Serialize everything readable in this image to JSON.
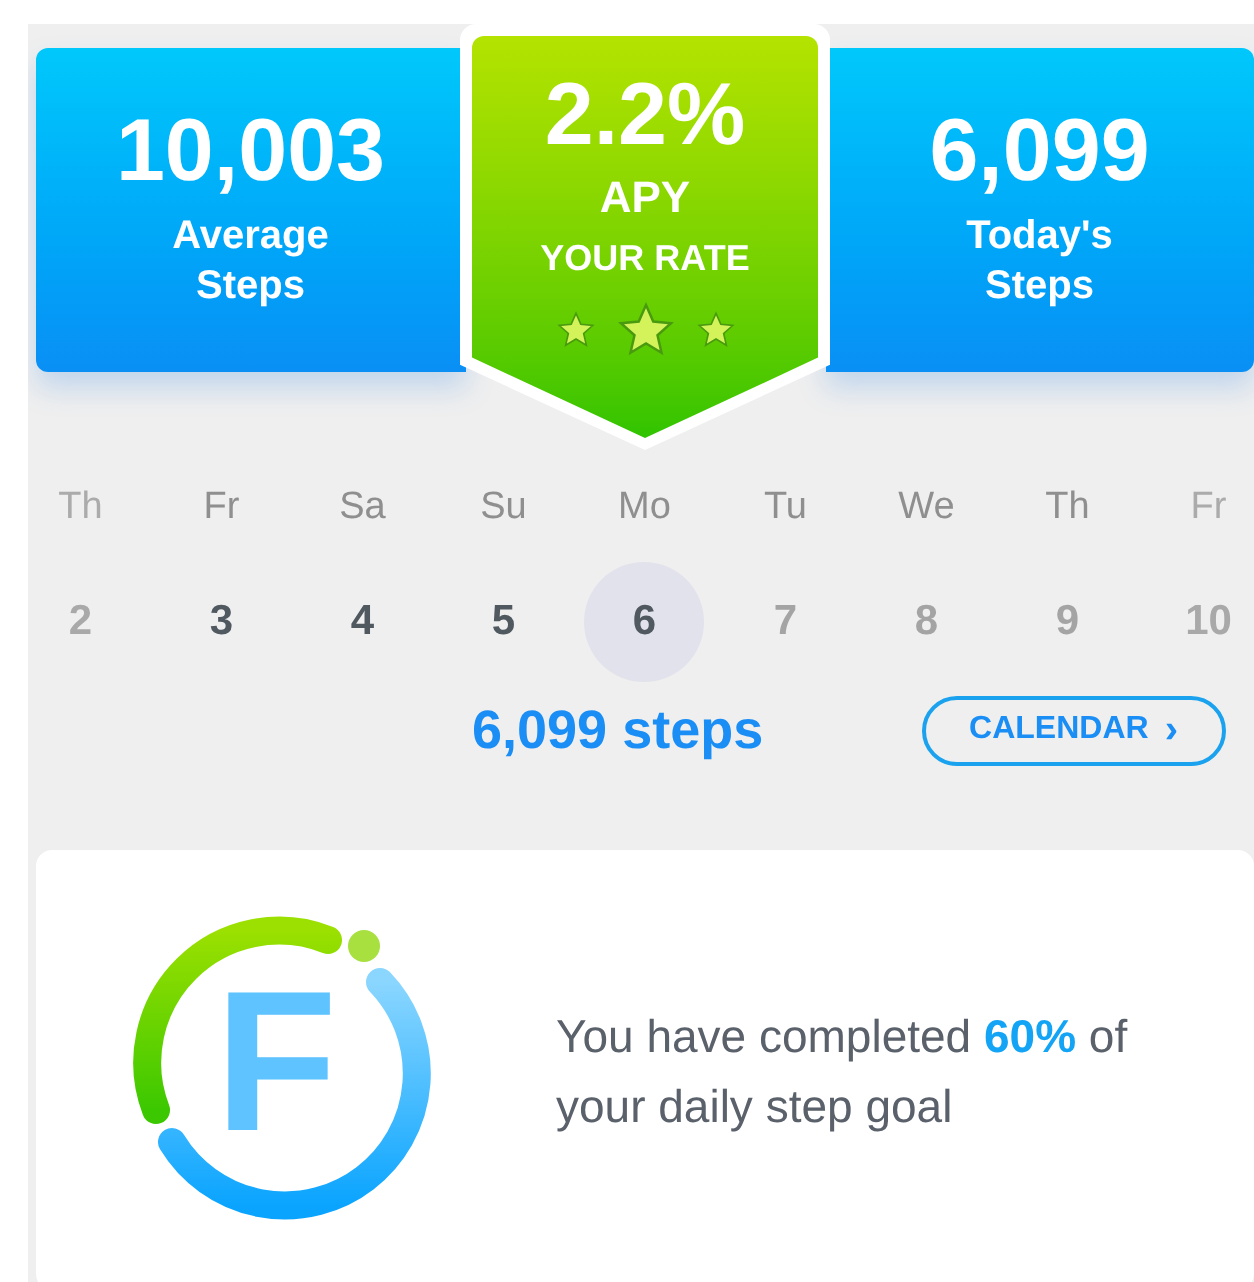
{
  "stats_left": {
    "value": "10,003",
    "label": "Average Steps"
  },
  "rate_badge": {
    "value": "2.2%",
    "unit": "APY",
    "caption": "YOUR RATE",
    "stars": 3
  },
  "stats_right": {
    "value": "6,099",
    "label": "Today's Steps"
  },
  "days": [
    {
      "weekday": "Th",
      "date": "2",
      "kind": "faded",
      "selected": false
    },
    {
      "weekday": "Fr",
      "date": "3",
      "kind": "past",
      "selected": false
    },
    {
      "weekday": "Sa",
      "date": "4",
      "kind": "past",
      "selected": false
    },
    {
      "weekday": "Su",
      "date": "5",
      "kind": "past",
      "selected": false
    },
    {
      "weekday": "Mo",
      "date": "6",
      "kind": "past",
      "selected": true
    },
    {
      "weekday": "Tu",
      "date": "7",
      "kind": "future",
      "selected": false
    },
    {
      "weekday": "We",
      "date": "8",
      "kind": "future",
      "selected": false
    },
    {
      "weekday": "Th",
      "date": "9",
      "kind": "future",
      "selected": false
    },
    {
      "weekday": "Fr",
      "date": "10",
      "kind": "faded",
      "selected": false
    }
  ],
  "steps_total": "6,099 steps",
  "calendar_button": {
    "label": "CALENDAR",
    "icon": "›"
  },
  "goal_card": {
    "logo_letter": "F",
    "message": "You have completed **60%** of your daily step goal"
  }
}
